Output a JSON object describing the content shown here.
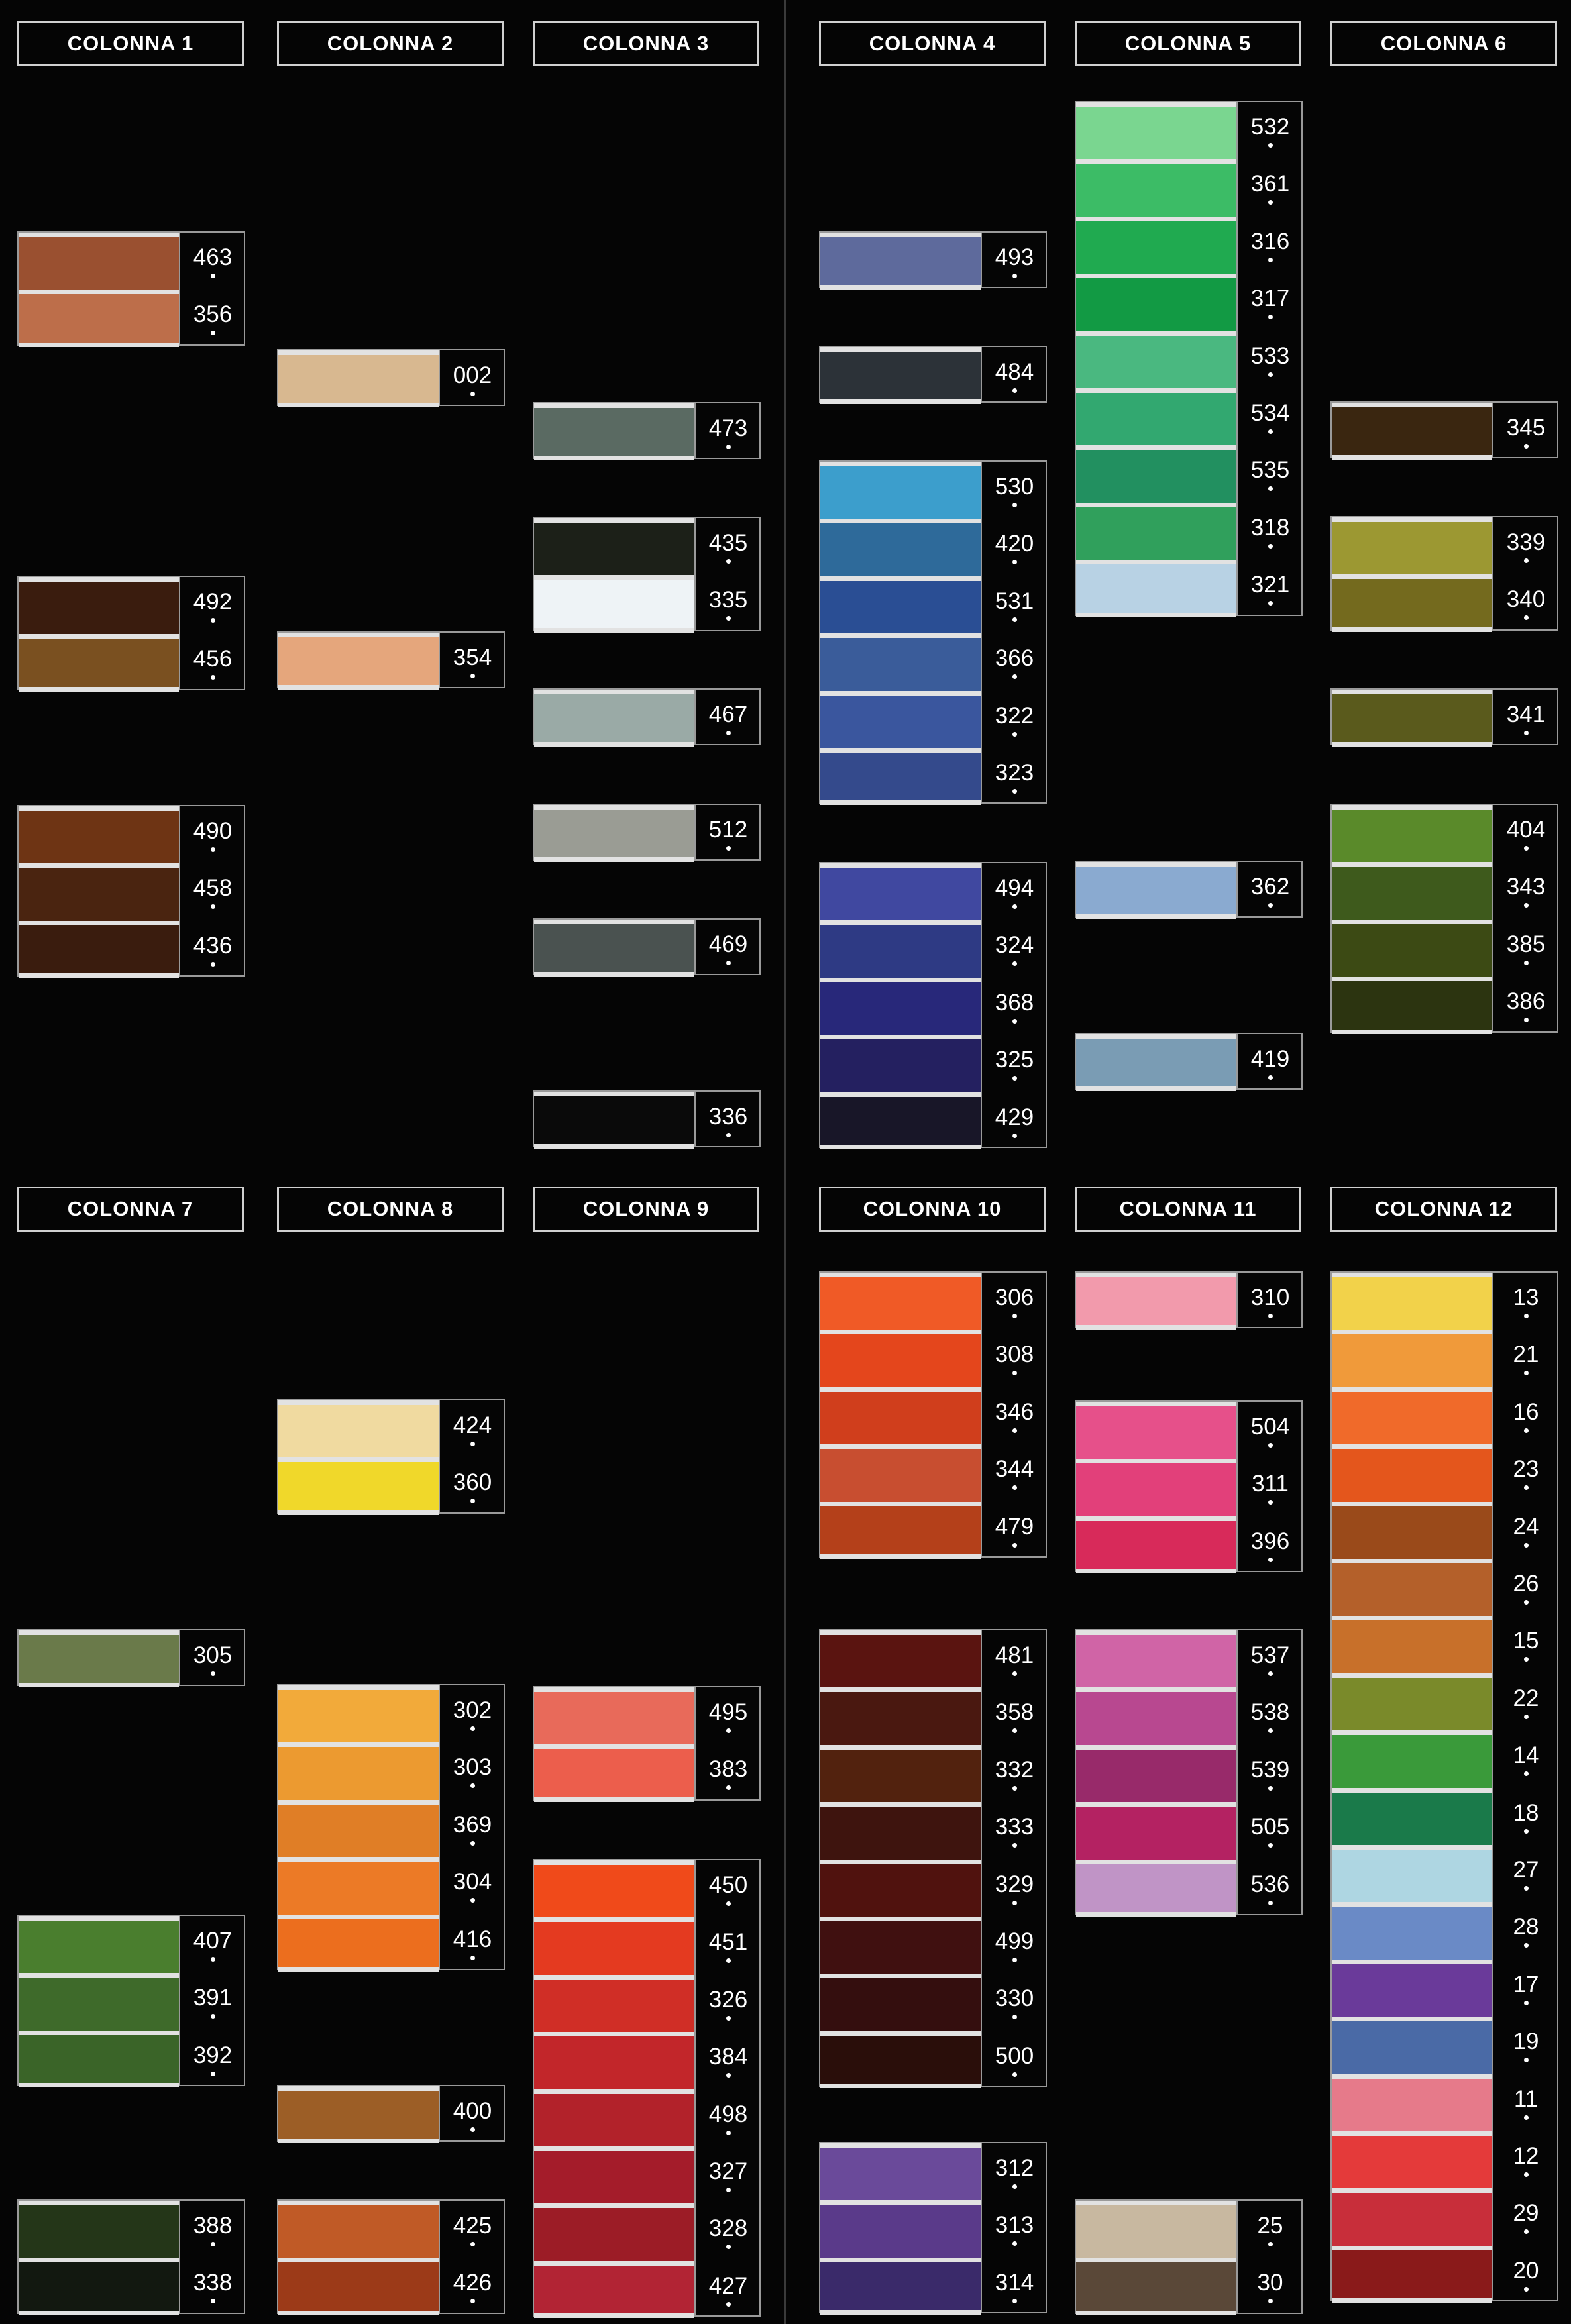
{
  "columns": [
    {
      "title": "COLONNA 1",
      "groups": [
        {
          "swatches": [
            {
              "code": "463",
              "color": "#9a5030"
            },
            {
              "code": "356",
              "color": "#bd6e4a"
            }
          ]
        },
        {
          "swatches": [
            {
              "code": "492",
              "color": "#3a1c0e"
            },
            {
              "code": "456",
              "color": "#7a5020"
            }
          ]
        },
        {
          "swatches": [
            {
              "code": "490",
              "color": "#6e3414"
            },
            {
              "code": "458",
              "color": "#4a2410"
            },
            {
              "code": "436",
              "color": "#3a1c0e"
            }
          ]
        }
      ]
    },
    {
      "title": "COLONNA 2",
      "groups": [
        {
          "swatches": [
            {
              "code": "002",
              "color": "#d8b890"
            }
          ]
        },
        {
          "swatches": [
            {
              "code": "354",
              "color": "#e5a67c"
            }
          ]
        }
      ]
    },
    {
      "title": "COLONNA 3",
      "groups": [
        {
          "swatches": [
            {
              "code": "473",
              "color": "#5a6a62"
            }
          ]
        },
        {
          "swatches": [
            {
              "code": "435",
              "color": "#1c2018"
            },
            {
              "code": "335",
              "color": "#eef3f6"
            }
          ]
        },
        {
          "swatches": [
            {
              "code": "467",
              "color": "#9aaaa6"
            }
          ]
        },
        {
          "swatches": [
            {
              "code": "512",
              "color": "#9a9c94"
            }
          ]
        },
        {
          "swatches": [
            {
              "code": "469",
              "color": "#4a5250"
            }
          ]
        },
        {
          "swatches": [
            {
              "code": "336",
              "color": "#0a0a0a"
            }
          ]
        }
      ]
    },
    {
      "title": "COLONNA 4",
      "groups": [
        {
          "swatches": [
            {
              "code": "493",
              "color": "#5e6a9c"
            }
          ]
        },
        {
          "swatches": [
            {
              "code": "484",
              "color": "#2c3238"
            }
          ]
        },
        {
          "swatches": [
            {
              "code": "530",
              "color": "#3c9ecc"
            },
            {
              "code": "420",
              "color": "#2e6a9a"
            },
            {
              "code": "531",
              "color": "#2a4e94"
            },
            {
              "code": "366",
              "color": "#3a5c9a"
            },
            {
              "code": "322",
              "color": "#3a569e"
            },
            {
              "code": "323",
              "color": "#344a8c"
            }
          ]
        },
        {
          "swatches": [
            {
              "code": "494",
              "color": "#4048a0"
            },
            {
              "code": "324",
              "color": "#2e3a84"
            },
            {
              "code": "368",
              "color": "#28287a"
            },
            {
              "code": "325",
              "color": "#242060"
            },
            {
              "code": "429",
              "color": "#181628"
            }
          ]
        }
      ]
    },
    {
      "title": "COLONNA 5",
      "groups": [
        {
          "swatches": [
            {
              "code": "532",
              "color": "#7ad690"
            },
            {
              "code": "361",
              "color": "#3cbc66"
            },
            {
              "code": "316",
              "color": "#20aa50"
            },
            {
              "code": "317",
              "color": "#129a44"
            },
            {
              "code": "533",
              "color": "#4ab880"
            },
            {
              "code": "534",
              "color": "#32a870"
            },
            {
              "code": "535",
              "color": "#229060"
            },
            {
              "code": "318",
              "color": "#30a05c"
            },
            {
              "code": "321",
              "color": "#b8d2e4"
            }
          ]
        },
        {
          "swatches": [
            {
              "code": "362",
              "color": "#8aaad0"
            }
          ]
        },
        {
          "swatches": [
            {
              "code": "419",
              "color": "#7a9cb4"
            }
          ]
        }
      ]
    },
    {
      "title": "COLONNA 6",
      "groups": [
        {
          "swatches": [
            {
              "code": "345",
              "color": "#3a2610"
            }
          ]
        },
        {
          "swatches": [
            {
              "code": "339",
              "color": "#9c9832"
            },
            {
              "code": "340",
              "color": "#746a1e"
            }
          ]
        },
        {
          "swatches": [
            {
              "code": "341",
              "color": "#5a5a1c"
            }
          ]
        },
        {
          "swatches": [
            {
              "code": "404",
              "color": "#5a8a2a"
            },
            {
              "code": "343",
              "color": "#3e5a1c"
            },
            {
              "code": "385",
              "color": "#3c4a14"
            },
            {
              "code": "386",
              "color": "#2c3410"
            }
          ]
        }
      ]
    },
    {
      "title": "COLONNA 7",
      "groups": [
        {
          "swatches": [
            {
              "code": "305",
              "color": "#6a7a4a"
            }
          ]
        },
        {
          "swatches": [
            {
              "code": "407",
              "color": "#4a7e2e"
            },
            {
              "code": "391",
              "color": "#3e6a2a"
            },
            {
              "code": "392",
              "color": "#3a6428"
            }
          ]
        },
        {
          "swatches": [
            {
              "code": "388",
              "color": "#243618"
            },
            {
              "code": "338",
              "color": "#121810"
            }
          ]
        }
      ]
    },
    {
      "title": "COLONNA 8",
      "groups": [
        {
          "swatches": [
            {
              "code": "424",
              "color": "#f0daa0"
            },
            {
              "code": "360",
              "color": "#f0d82a"
            }
          ]
        },
        {
          "swatches": [
            {
              "code": "302",
              "color": "#f2aa3a"
            },
            {
              "code": "303",
              "color": "#ec9a30"
            },
            {
              "code": "369",
              "color": "#e07e26"
            },
            {
              "code": "304",
              "color": "#ec7a26"
            },
            {
              "code": "416",
              "color": "#ec6e1e"
            }
          ]
        },
        {
          "swatches": [
            {
              "code": "400",
              "color": "#9c5e26"
            }
          ]
        },
        {
          "swatches": [
            {
              "code": "425",
              "color": "#c05a26"
            },
            {
              "code": "426",
              "color": "#9c3a18"
            }
          ]
        }
      ]
    },
    {
      "title": "COLONNA 9",
      "groups": [
        {
          "swatches": [
            {
              "code": "495",
              "color": "#e86a5a"
            },
            {
              "code": "383",
              "color": "#ec5e4c"
            }
          ]
        },
        {
          "swatches": [
            {
              "code": "450",
              "color": "#f04a1a"
            },
            {
              "code": "451",
              "color": "#e43a20"
            },
            {
              "code": "326",
              "color": "#d02e26"
            },
            {
              "code": "384",
              "color": "#c2262a"
            },
            {
              "code": "498",
              "color": "#b2222a"
            },
            {
              "code": "327",
              "color": "#a41c2a"
            },
            {
              "code": "328",
              "color": "#9c1c26"
            },
            {
              "code": "427",
              "color": "#b22434"
            }
          ]
        }
      ]
    },
    {
      "title": "COLONNA 10",
      "groups": [
        {
          "swatches": [
            {
              "code": "306",
              "color": "#f05a26"
            },
            {
              "code": "308",
              "color": "#e4461c"
            },
            {
              "code": "346",
              "color": "#d03e1c"
            },
            {
              "code": "344",
              "color": "#c84e30"
            },
            {
              "code": "479",
              "color": "#b4401a"
            }
          ]
        },
        {
          "swatches": [
            {
              "code": "481",
              "color": "#5a1410"
            },
            {
              "code": "358",
              "color": "#4a1810"
            },
            {
              "code": "332",
              "color": "#52220e"
            },
            {
              "code": "333",
              "color": "#3e140e"
            },
            {
              "code": "329",
              "color": "#50120e"
            },
            {
              "code": "499",
              "color": "#401010"
            },
            {
              "code": "330",
              "color": "#340e0e"
            },
            {
              "code": "500",
              "color": "#2a0e0a"
            }
          ]
        },
        {
          "swatches": [
            {
              "code": "312",
              "color": "#6a4a9a"
            },
            {
              "code": "313",
              "color": "#5a3a8a"
            },
            {
              "code": "314",
              "color": "#3a2a6a"
            }
          ]
        }
      ]
    },
    {
      "title": "COLONNA 11",
      "groups": [
        {
          "swatches": [
            {
              "code": "310",
              "color": "#f29aac"
            }
          ]
        },
        {
          "swatches": [
            {
              "code": "504",
              "color": "#e6508a"
            },
            {
              "code": "311",
              "color": "#e2407a"
            },
            {
              "code": "396",
              "color": "#d82a5a"
            }
          ]
        },
        {
          "swatches": [
            {
              "code": "537",
              "color": "#d064a6"
            },
            {
              "code": "538",
              "color": "#b84890"
            },
            {
              "code": "539",
              "color": "#982a6a"
            },
            {
              "code": "505",
              "color": "#b42262"
            },
            {
              "code": "536",
              "color": "#c094c6"
            }
          ]
        },
        {
          "swatches": [
            {
              "code": "25",
              "color": "#c8b8a0"
            },
            {
              "code": "30",
              "color": "#5a4838"
            }
          ]
        }
      ]
    },
    {
      "title": "COLONNA 12",
      "groups": [
        {
          "swatches": [
            {
              "code": "13",
              "color": "#f2d24a"
            },
            {
              "code": "21",
              "color": "#f09a3a"
            },
            {
              "code": "16",
              "color": "#f06a2a"
            },
            {
              "code": "23",
              "color": "#e4561c"
            },
            {
              "code": "24",
              "color": "#9a4a1a"
            },
            {
              "code": "26",
              "color": "#b4602a"
            },
            {
              "code": "15",
              "color": "#c8702a"
            },
            {
              "code": "22",
              "color": "#7a8a2a"
            },
            {
              "code": "14",
              "color": "#3a9a3a"
            },
            {
              "code": "18",
              "color": "#1a7a4a"
            },
            {
              "code": "27",
              "color": "#aed6e2"
            },
            {
              "code": "28",
              "color": "#6a8ac6"
            },
            {
              "code": "17",
              "color": "#6a3a9a"
            },
            {
              "code": "19",
              "color": "#4a6aa6"
            },
            {
              "code": "11",
              "color": "#e67a8a"
            },
            {
              "code": "12",
              "color": "#e43a3a"
            },
            {
              "code": "29",
              "color": "#c82e3a"
            },
            {
              "code": "20",
              "color": "#8a1a1a"
            }
          ]
        }
      ]
    }
  ]
}
